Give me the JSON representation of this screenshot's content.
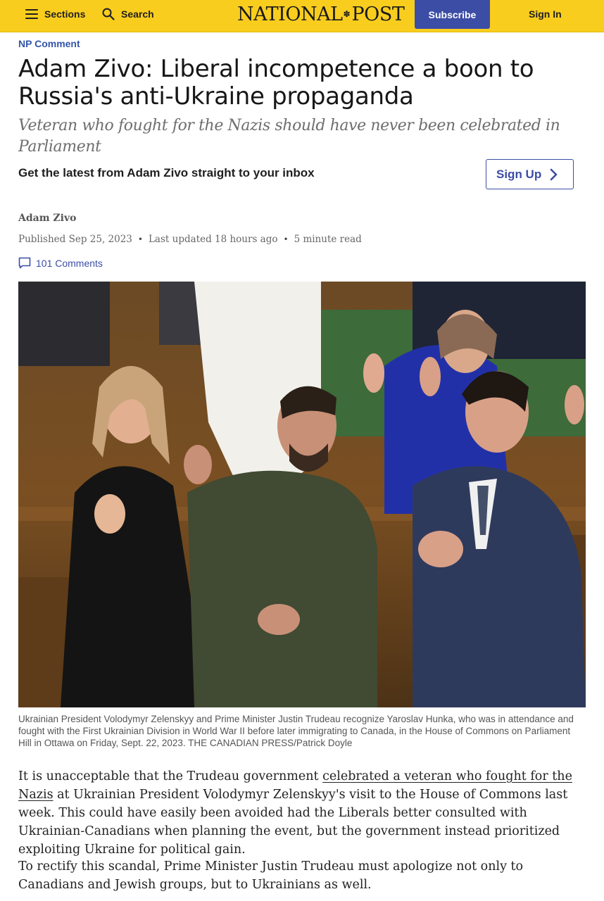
{
  "header": {
    "sections_label": "Sections",
    "search_label": "Search",
    "logo_left": "NATIONAL",
    "logo_right": "POST",
    "subscribe_label": "Subscribe",
    "signin_label": "Sign In"
  },
  "article": {
    "section": "NP Comment",
    "headline": "Adam Zivo: Liberal incompetence a boon to Russia's anti-Ukraine propaganda",
    "dek": "Veteran who fought for the Nazis should have never been celebrated in Parliament",
    "newsletter_text": "Get the latest from Adam Zivo straight to your inbox",
    "signup_label": "Sign Up",
    "author": "Adam Zivo",
    "published": "Published Sep 25, 2023",
    "updated": "Last updated 18 hours ago",
    "read_time": "5 minute read",
    "comments": "101 Comments",
    "caption": "Ukrainian President Volodymyr Zelenskyy and Prime Minister Justin Trudeau recognize Yaroslav Hunka, who was in attendance and fought with the First Ukrainian Division in World War II before later immigrating to Canada, in the House of Commons on Parliament Hill in Ottawa on Friday, Sept. 22, 2023. THE CANADIAN PRESS/Patrick Doyle",
    "paragraph1": {
      "before": "It is unacceptable that the Trudeau government ",
      "link": "celebrated a veteran who fought for the Nazis",
      "after": " at Ukrainian President Volodymyr Zelenskyy's visit to the House of Commons last week. This could have easily been avoided had the Liberals better consulted with Ukrainian-Canadians when planning the event, but the government instead prioritized exploiting Ukraine for political gain."
    },
    "paragraph2": "To rectify this scandal, Prime Minister Justin Trudeau must apologize not only to Canadians and Jewish groups, but to Ukrainians as well."
  },
  "colors": {
    "header_bg": "#f9cd1e",
    "brand_blue": "#3c4da6",
    "link_blue": "#3255a9"
  },
  "icons": [
    "hamburger-icon",
    "search-icon",
    "chevron-right-icon",
    "comment-icon",
    "maple-leaf-icon"
  ]
}
